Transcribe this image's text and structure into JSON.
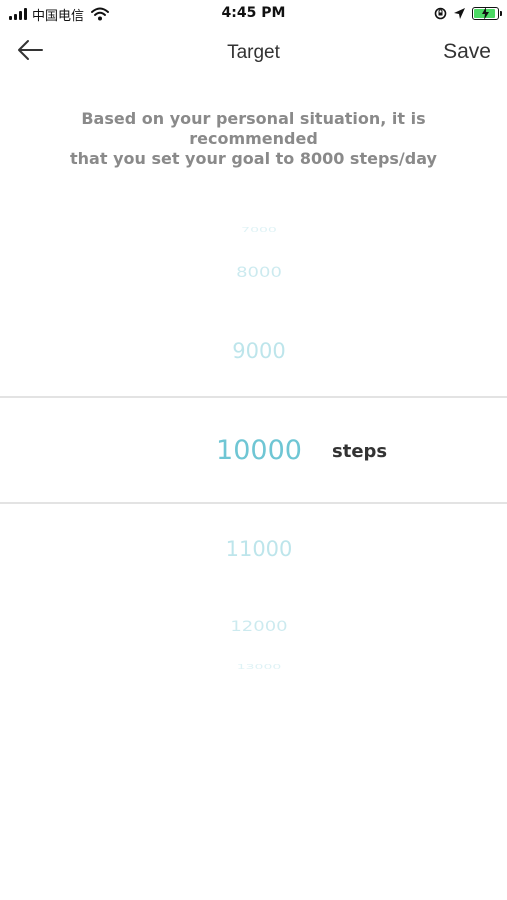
{
  "status_bar": {
    "carrier": "中国电信",
    "time": "4:45 PM",
    "icons": [
      "signal-icon",
      "wifi-icon",
      "rotation-lock-icon",
      "location-icon",
      "battery-charging-icon"
    ],
    "battery_color": "#4cd964"
  },
  "nav": {
    "back_icon": "arrow-left-icon",
    "title": "Target",
    "save_label": "Save"
  },
  "recommendation": {
    "line1": "Based on your personal situation, it is recommended",
    "line2": "that you set your goal to 8000 steps/day"
  },
  "picker": {
    "items": [
      "7000",
      "8000",
      "9000",
      "10000",
      "11000",
      "12000",
      "13000"
    ],
    "selected": "10000",
    "unit": "steps",
    "accent_color": "#6fc6d4"
  }
}
